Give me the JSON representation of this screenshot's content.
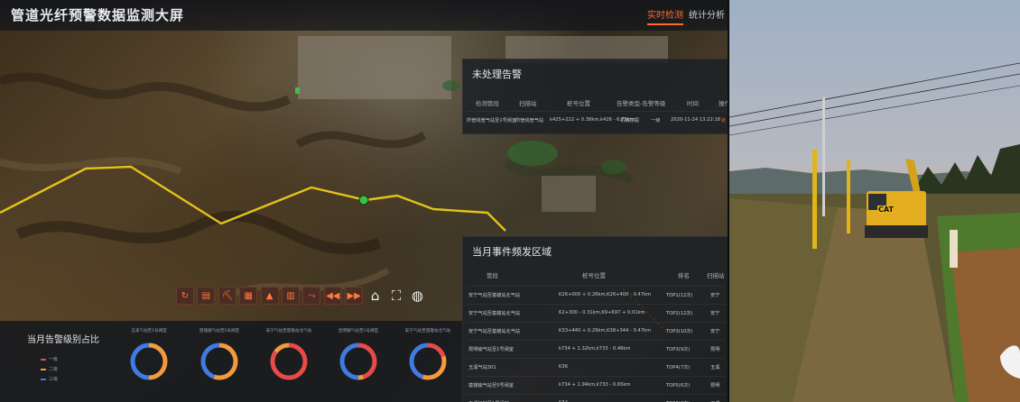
{
  "header": {
    "title": "管道光纤预警数据监测大屏",
    "tabs": [
      {
        "label": "实时检测",
        "active": true
      },
      {
        "label": "统计分析",
        "active": false
      }
    ]
  },
  "alarms_panel": {
    "title": "未处理告警",
    "columns": [
      "检测管段",
      "扫描站",
      "桩号位置",
      "告警类型-告警等级",
      "时间",
      "操作"
    ],
    "rows": [
      [
        "所管线管气站至1号阀室",
        "所管线管气站",
        "k425+222 + 0.38km,k426 - 6.75km",
        "机械挖掘",
        "一级",
        "2020-11-24 13:22:18",
        "处"
      ]
    ]
  },
  "hotspot_panel": {
    "title": "当月事件频发区域",
    "columns": [
      "管段",
      "桩号位置",
      "排名",
      "扫描站"
    ],
    "rows": [
      [
        "安宁气站至楚雄站北气站",
        "K26+000 + 0.26km,K26+400 - 0.47km",
        "TOP1(12次)",
        "安宁"
      ],
      [
        "安宁气站至楚雄站北气站",
        "K2+300 - 0.31km,K9+697 + 0.01km",
        "TOP2(12次)",
        "安宁"
      ],
      [
        "安宁气站至楚雄站北气站",
        "K33+440 + 0.29km,K38+344 - 0.47km",
        "TOP3(10次)",
        "安宁"
      ],
      [
        "昆明输气站至1号阀室",
        "k734 + 1.32km,k733 - 0.46km",
        "TOP3(9次)",
        "昆明"
      ],
      [
        "玉溪气站301",
        "K36",
        "TOP4(7次)",
        "玉溪"
      ],
      [
        "楚雄输气站至5号阀室",
        "k734 + 1.94km,k733 - 0.65km",
        "TOP5(6次)",
        "昆明"
      ],
      [
        "玉溪气站至1号阀室",
        "K34",
        "TOP6(3次)",
        "玉溪"
      ]
    ]
  },
  "toolbar": [
    {
      "name": "refresh-icon",
      "glyph": "↻"
    },
    {
      "name": "alarm-list-icon",
      "glyph": "▤"
    },
    {
      "name": "excavator-icon",
      "glyph": "⛏"
    },
    {
      "name": "building-icon",
      "glyph": "▦"
    },
    {
      "name": "warning-light-icon",
      "glyph": "▲"
    },
    {
      "name": "report-icon",
      "glyph": "▥"
    },
    {
      "name": "route-icon",
      "glyph": "⤳"
    },
    {
      "name": "rewind-icon",
      "glyph": "◀◀"
    },
    {
      "name": "fast-forward-icon",
      "glyph": "▶▶"
    },
    {
      "name": "home-icon",
      "glyph": "⌂"
    },
    {
      "name": "fullscreen-icon",
      "glyph": "⛶"
    },
    {
      "name": "globe-icon",
      "glyph": "◍"
    }
  ],
  "level_panel": {
    "title": "当月告警级别占比",
    "legend": [
      {
        "label": "一级",
        "color": "#e84a4a"
      },
      {
        "label": "二级",
        "color": "#f39a3c"
      },
      {
        "label": "三级",
        "color": "#3f7be0"
      }
    ],
    "donuts": [
      {
        "label": "玉溪气站至1号阀室",
        "level1": 0.0,
        "level2": 0.5,
        "level3": 0.5
      },
      {
        "label": "楚雄输气站至5号阀室",
        "level1": 0.0,
        "level2": 0.55,
        "level3": 0.45
      },
      {
        "label": "安宁气站至楚雄站北气站",
        "level1": 0.85,
        "level2": 0.15,
        "level3": 0.0
      },
      {
        "label": "昆明输气站至1号阀室",
        "level1": 0.45,
        "level2": 0.05,
        "level3": 0.5
      },
      {
        "label": "安宁气站至楚雄站北气站",
        "level1": 0.2,
        "level2": 0.35,
        "level3": 0.45
      }
    ]
  },
  "colors": {
    "accent": "#ff6a2c",
    "pipeline": "#e3c21a",
    "marker": "#38c24a"
  },
  "photo": {
    "excavator_label": "CAT"
  }
}
